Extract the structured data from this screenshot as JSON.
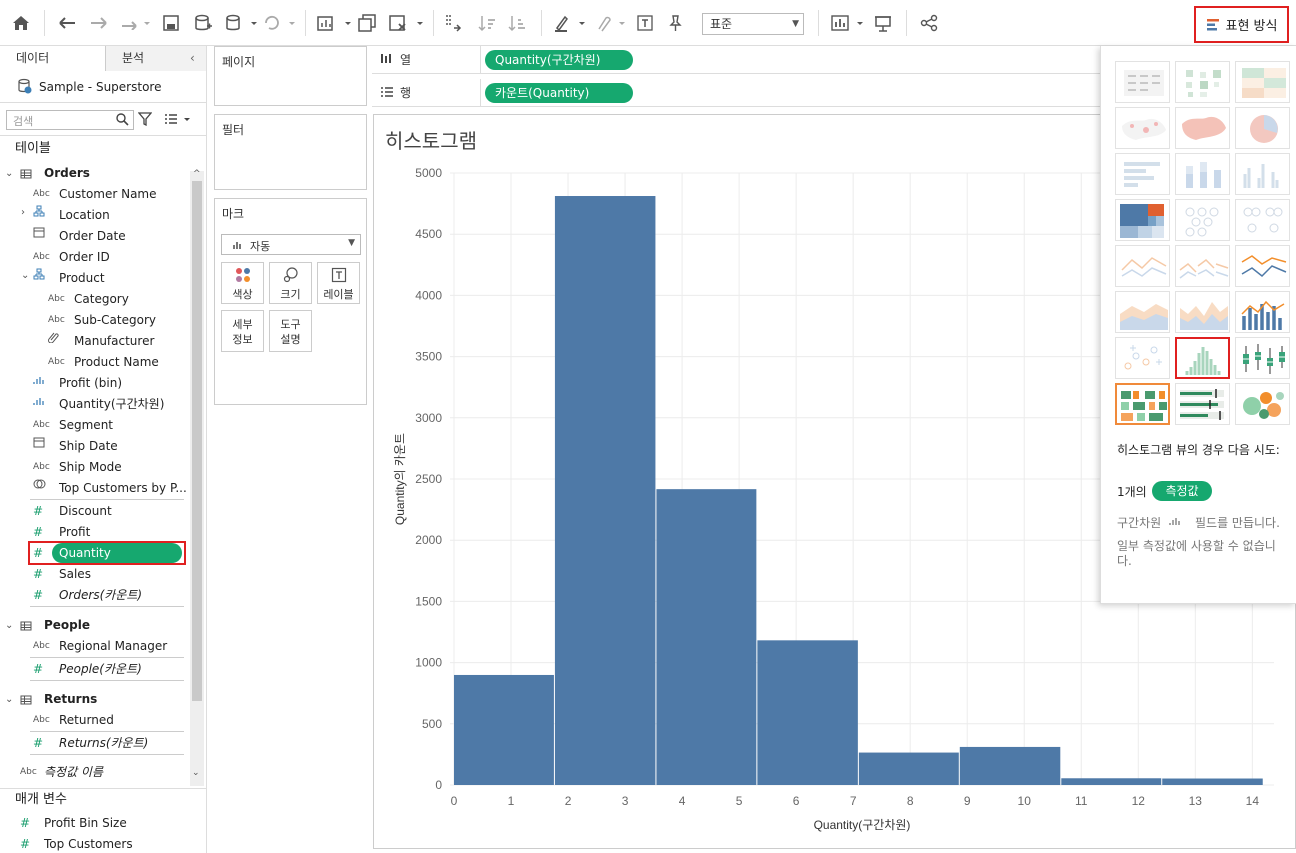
{
  "toolbar": {
    "fit_select": "표준",
    "show_me_label": "표현 방식"
  },
  "datapane": {
    "tabs": [
      "데이터",
      "분석"
    ],
    "datasource": "Sample - Superstore",
    "search_placeholder": "검색",
    "tables_heading": "테이블",
    "orders": {
      "name": "Orders",
      "fields": [
        {
          "type": "Abc",
          "label": "Customer Name"
        },
        {
          "type": "hier",
          "label": "Location"
        },
        {
          "type": "date",
          "label": "Order Date"
        },
        {
          "type": "Abc",
          "label": "Order ID"
        },
        {
          "type": "hier",
          "label": "Product"
        },
        {
          "type": "Abc",
          "label": "Category"
        },
        {
          "type": "Abc",
          "label": "Sub-Category"
        },
        {
          "type": "clip",
          "label": "Manufacturer"
        },
        {
          "type": "Abc",
          "label": "Product Name"
        },
        {
          "type": "bin",
          "label": "Profit (bin)"
        },
        {
          "type": "bin",
          "label": "Quantity(구간차원)"
        },
        {
          "type": "Abc",
          "label": "Segment"
        },
        {
          "type": "date",
          "label": "Ship Date"
        },
        {
          "type": "Abc",
          "label": "Ship Mode"
        },
        {
          "type": "set",
          "label": "Top Customers by P..."
        },
        {
          "type": "#",
          "label": "Discount"
        },
        {
          "type": "#",
          "label": "Profit"
        },
        {
          "type": "#",
          "label": "Quantity"
        },
        {
          "type": "#",
          "label": "Sales"
        },
        {
          "type": "#",
          "label": "Orders(카운트)"
        }
      ]
    },
    "people": {
      "name": "People",
      "fields": [
        {
          "type": "Abc",
          "label": "Regional Manager"
        },
        {
          "type": "#",
          "label": "People(카운트)"
        }
      ]
    },
    "returns": {
      "name": "Returns",
      "fields": [
        {
          "type": "Abc",
          "label": "Returned"
        },
        {
          "type": "#",
          "label": "Returns(카운트)"
        }
      ]
    },
    "measure_names": {
      "type": "Abc",
      "label": "측정값 이름"
    },
    "parameters_heading": "매개 변수",
    "parameters": [
      {
        "type": "#",
        "label": "Profit Bin Size"
      },
      {
        "type": "#",
        "label": "Top Customers"
      }
    ]
  },
  "shelves": {
    "pages": "페이지",
    "filters": "필터",
    "marks": "마크",
    "mark_type": "자동",
    "mark_buttons": [
      {
        "icon": "color-icon",
        "label": "색상"
      },
      {
        "icon": "size-icon",
        "label": "크기"
      },
      {
        "icon": "label-icon",
        "label": "레이블"
      },
      {
        "icon": "",
        "label": "세부\n정보"
      },
      {
        "icon": "",
        "label": "도구\n설명"
      }
    ],
    "columns_label": "열",
    "rows_label": "행",
    "columns_pill": "Quantity(구간차원)",
    "rows_pill": "카운트(Quantity)"
  },
  "chart_data": {
    "type": "bar",
    "title": "히스토그램",
    "xlabel": "Quantity(구간차원)",
    "ylabel": "Quantity의 카운트",
    "ylim": [
      0,
      5000
    ],
    "yticks": [
      0,
      500,
      1000,
      1500,
      2000,
      2500,
      3000,
      3500,
      4000,
      4500,
      5000
    ],
    "xticks": [
      "0",
      "1",
      "2",
      "3",
      "4",
      "5",
      "6",
      "7",
      "8",
      "9",
      "10",
      "11",
      "12",
      "13",
      "14"
    ],
    "xlim": [
      -0.07,
      14.38
    ],
    "bins": [
      {
        "start": 0,
        "end": 1.77,
        "value": 899
      },
      {
        "start": 1.77,
        "end": 3.55,
        "value": 4812
      },
      {
        "start": 3.55,
        "end": 5.32,
        "value": 2417
      },
      {
        "start": 5.32,
        "end": 7.1,
        "value": 1182
      },
      {
        "start": 7.1,
        "end": 8.87,
        "value": 265
      },
      {
        "start": 8.87,
        "end": 10.65,
        "value": 311
      },
      {
        "start": 10.65,
        "end": 12.42,
        "value": 55
      },
      {
        "start": 12.42,
        "end": 14.2,
        "value": 53
      }
    ],
    "bar_color": "#4e79a7",
    "grid": true
  },
  "showme": {
    "hint_title": "히스토그램 뷰의 경우 다음 시도:",
    "count_prefix": "1개의",
    "count_pill": "측정값",
    "line1_prefix": "구간차원",
    "line1_suffix": "필드를 만듭니다.",
    "line2": "일부 측정값에 사용할 수 없습니다."
  }
}
